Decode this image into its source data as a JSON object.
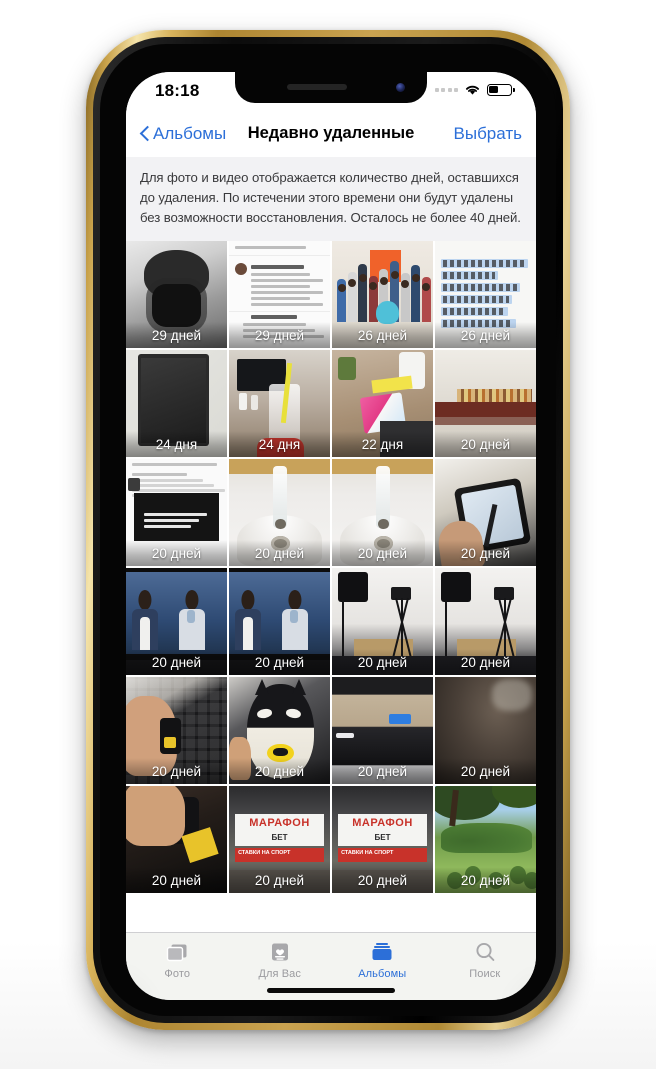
{
  "device": {
    "frame_color": "#caa350",
    "bezel_color": "#050505"
  },
  "status_bar": {
    "time": "18:18",
    "signal_icon": "signal-dots-icon",
    "wifi_icon": "wifi-icon",
    "battery_icon": "battery-icon",
    "battery_level_percent": 42
  },
  "nav_bar": {
    "back_label": "Альбомы",
    "back_icon": "chevron-left-icon",
    "title": "Недавно удаленные",
    "action_label": "Выбрать"
  },
  "description": "Для фото и видео отображается количество дней, оставшихся до удаления. По истечении этого времени они будут удалены без возможности восстановления. Осталось не более 40 дней.",
  "accent_color": "#2c6fd8",
  "photos": [
    {
      "days_label": "29 дней",
      "art": "a-photog",
      "name": "photo-photographer-selfie"
    },
    {
      "days_label": "29 дней",
      "art": "a-tweet",
      "name": "photo-tweet-screenshot"
    },
    {
      "days_label": "26 дней",
      "art": "a-group",
      "name": "photo-group-people"
    },
    {
      "days_label": "26 дней",
      "art": "a-text",
      "name": "photo-text-selection"
    },
    {
      "days_label": "24 дня",
      "art": "a-monitor",
      "name": "photo-dark-monitor"
    },
    {
      "days_label": "24 дня",
      "art": "a-cup",
      "name": "photo-cup-straw"
    },
    {
      "days_label": "22 дня",
      "art": "a-desk",
      "name": "photo-desk-package"
    },
    {
      "days_label": "20 дней",
      "art": "a-shelf",
      "name": "photo-shelf-pencils"
    },
    {
      "days_label": "20 дней",
      "art": "a-news",
      "name": "photo-news-screenshot"
    },
    {
      "days_label": "20 дней",
      "art": "a-sink",
      "name": "photo-sink-water-1"
    },
    {
      "days_label": "20 дней",
      "art": "a-sink",
      "name": "photo-sink-water-2"
    },
    {
      "days_label": "20 дней",
      "art": "a-tablet",
      "name": "photo-tablet-writing"
    },
    {
      "days_label": "20 дней",
      "art": "a-tv",
      "name": "photo-tv-two-men-1"
    },
    {
      "days_label": "20 дней",
      "art": "a-tv",
      "name": "photo-tv-two-men-2"
    },
    {
      "days_label": "20 дней",
      "art": "a-tripod",
      "name": "photo-studio-tripod-1"
    },
    {
      "days_label": "20 дней",
      "art": "a-tripod",
      "name": "photo-studio-tripod-2"
    },
    {
      "days_label": "20 дней",
      "art": "a-usb",
      "name": "photo-hand-usb-figure"
    },
    {
      "days_label": "20 дней",
      "art": "a-batman",
      "name": "photo-batman-bank"
    },
    {
      "days_label": "20 дней",
      "art": "a-screen",
      "name": "photo-monitor-edge"
    },
    {
      "days_label": "20 дней",
      "art": "a-blur",
      "name": "photo-blurred-dark"
    },
    {
      "days_label": "20 дней",
      "art": "a-hand2",
      "name": "photo-hand-object"
    },
    {
      "days_label": "20 дней",
      "art": "a-mb",
      "name": "photo-marathonbet-sign-1"
    },
    {
      "days_label": "20 дней",
      "art": "a-mb",
      "name": "photo-marathonbet-sign-2"
    },
    {
      "days_label": "20 дней",
      "art": "a-park",
      "name": "photo-park-trees"
    }
  ],
  "billboard": {
    "brand": "МАРАФОН",
    "sub": "БЕТ",
    "strip": "СТАВКИ НА СПОРТ"
  },
  "tab_bar": {
    "tabs": [
      {
        "label": "Фото",
        "icon": "photos-icon",
        "active": false
      },
      {
        "label": "Для Вас",
        "icon": "foryou-icon",
        "active": false
      },
      {
        "label": "Альбомы",
        "icon": "albums-icon",
        "active": true
      },
      {
        "label": "Поиск",
        "icon": "search-icon",
        "active": false
      }
    ]
  }
}
